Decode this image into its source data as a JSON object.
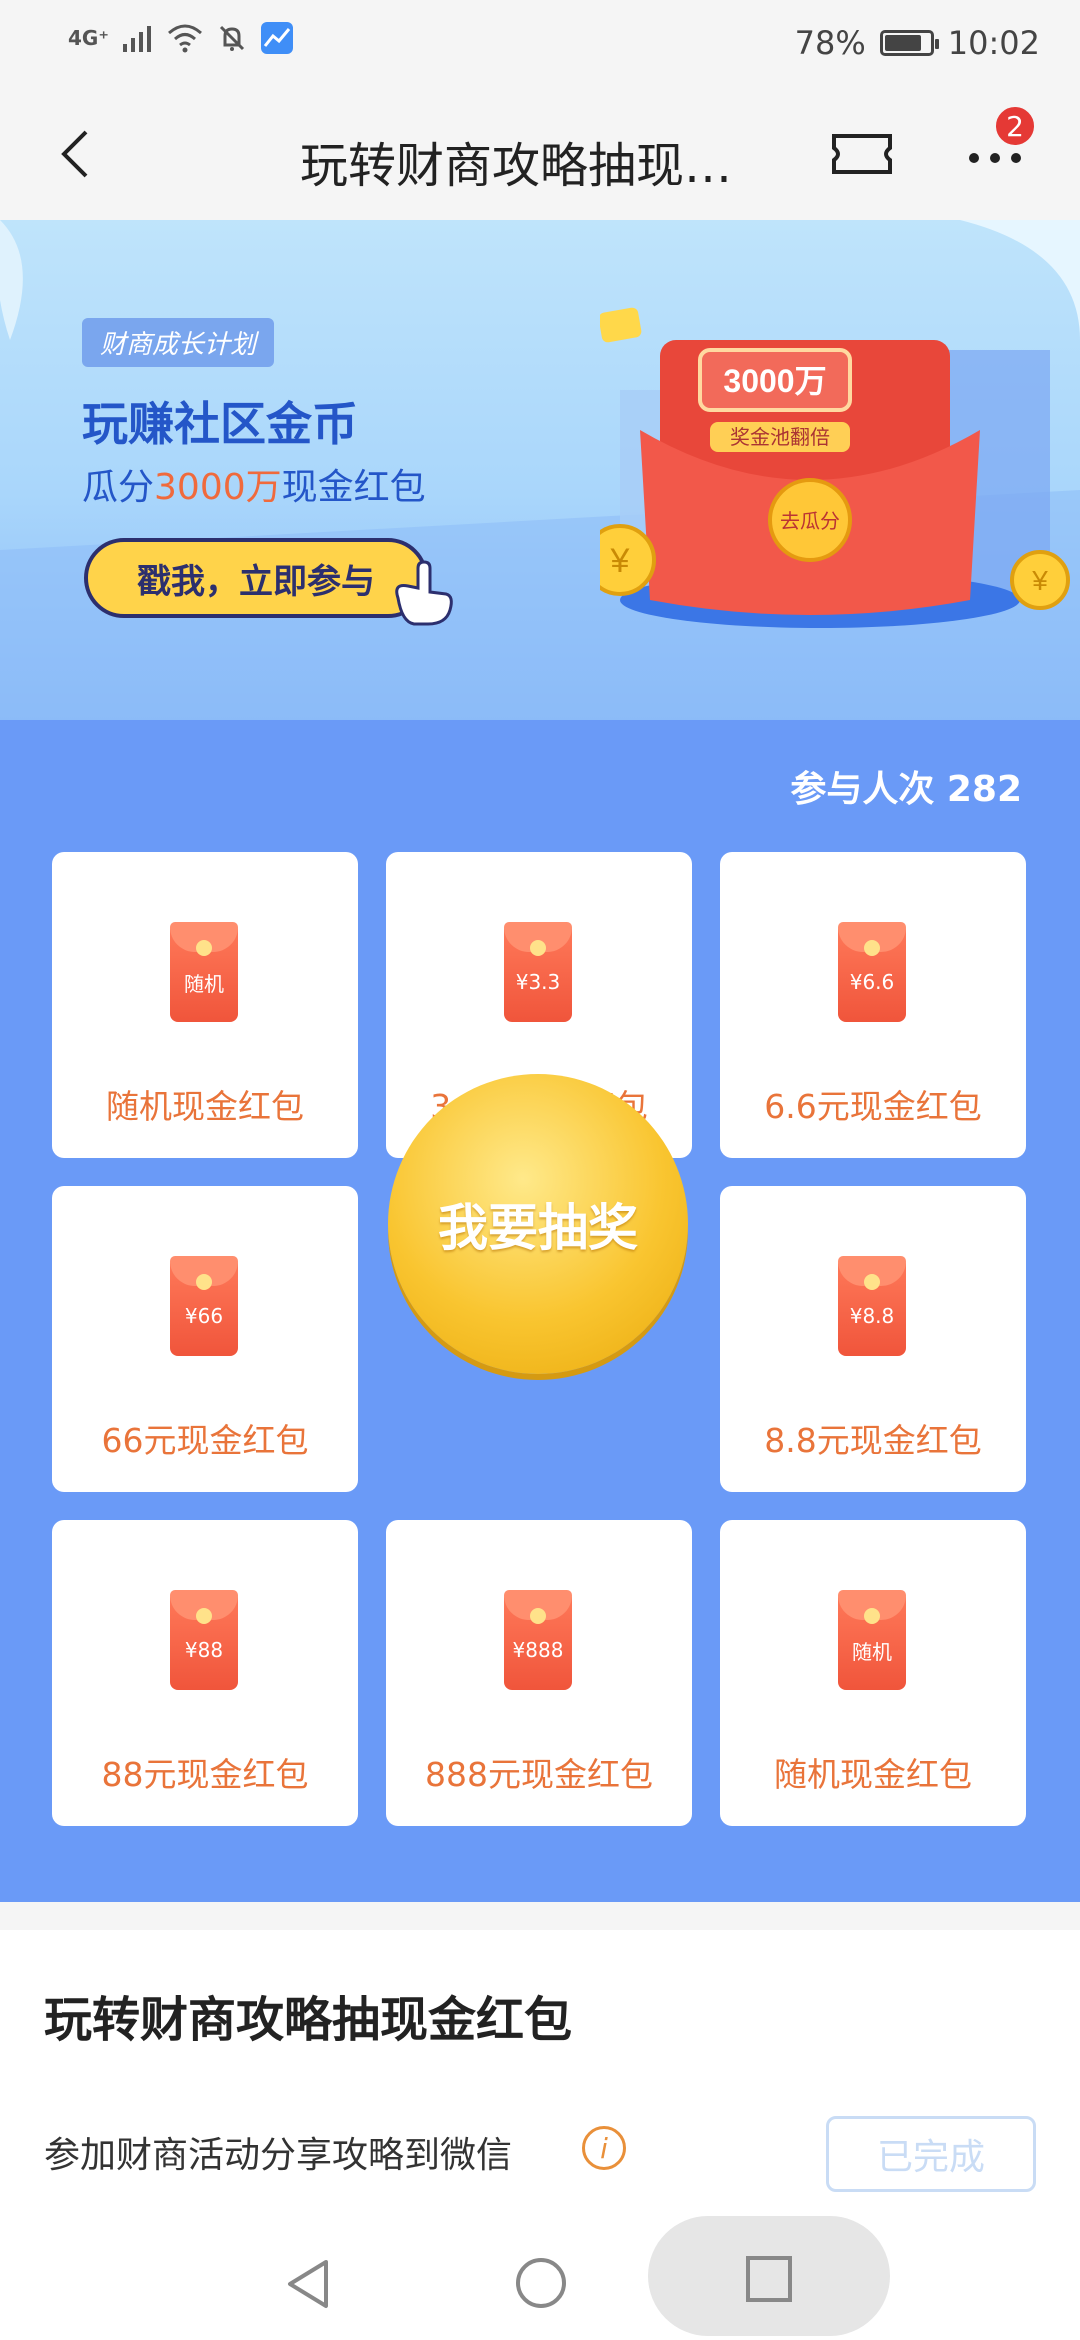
{
  "status_bar": {
    "network": "4G⁺",
    "battery": "78%",
    "time": "10:02"
  },
  "nav": {
    "title": "玩转财商攻略抽现…",
    "badge_count": "2"
  },
  "banner": {
    "tag": "财商成长计划",
    "headline": "玩赚社区金币",
    "sub_prefix": "瓜分",
    "sub_highlight": "3000万",
    "sub_suffix": "现金红包",
    "cta": "戳我，立即参与",
    "art_amount": "3000万",
    "art_pool": "奖金池翻倍",
    "art_coin": "去瓜分"
  },
  "participants": "参与人次 282",
  "grid": {
    "cells": [
      {
        "pkt": "随机",
        "label": "随机现金红包"
      },
      {
        "pkt": "¥3.3",
        "label": "3.3元现金红包"
      },
      {
        "pkt": "¥6.6",
        "label": "6.6元现金红包"
      },
      {
        "pkt": "¥66",
        "label": "66元现金红包"
      },
      {
        "pkt": "¥8.8",
        "label": "8.8元现金红包"
      },
      {
        "pkt": "¥88",
        "label": "88元现金红包"
      },
      {
        "pkt": "¥888",
        "label": "888元现金红包"
      },
      {
        "pkt": "随机",
        "label": "随机现金红包"
      }
    ],
    "draw_button": "我要抽奖"
  },
  "task": {
    "title": "玩转财商攻略抽现金红包",
    "desc": "参加财商活动分享攻略到微信",
    "status": "已完成"
  },
  "colors": {
    "hero_bg": "#6a9af7",
    "accent_orange": "#e9743a",
    "packet_red": "#f0553b",
    "draw_gold": "#f9c530"
  }
}
